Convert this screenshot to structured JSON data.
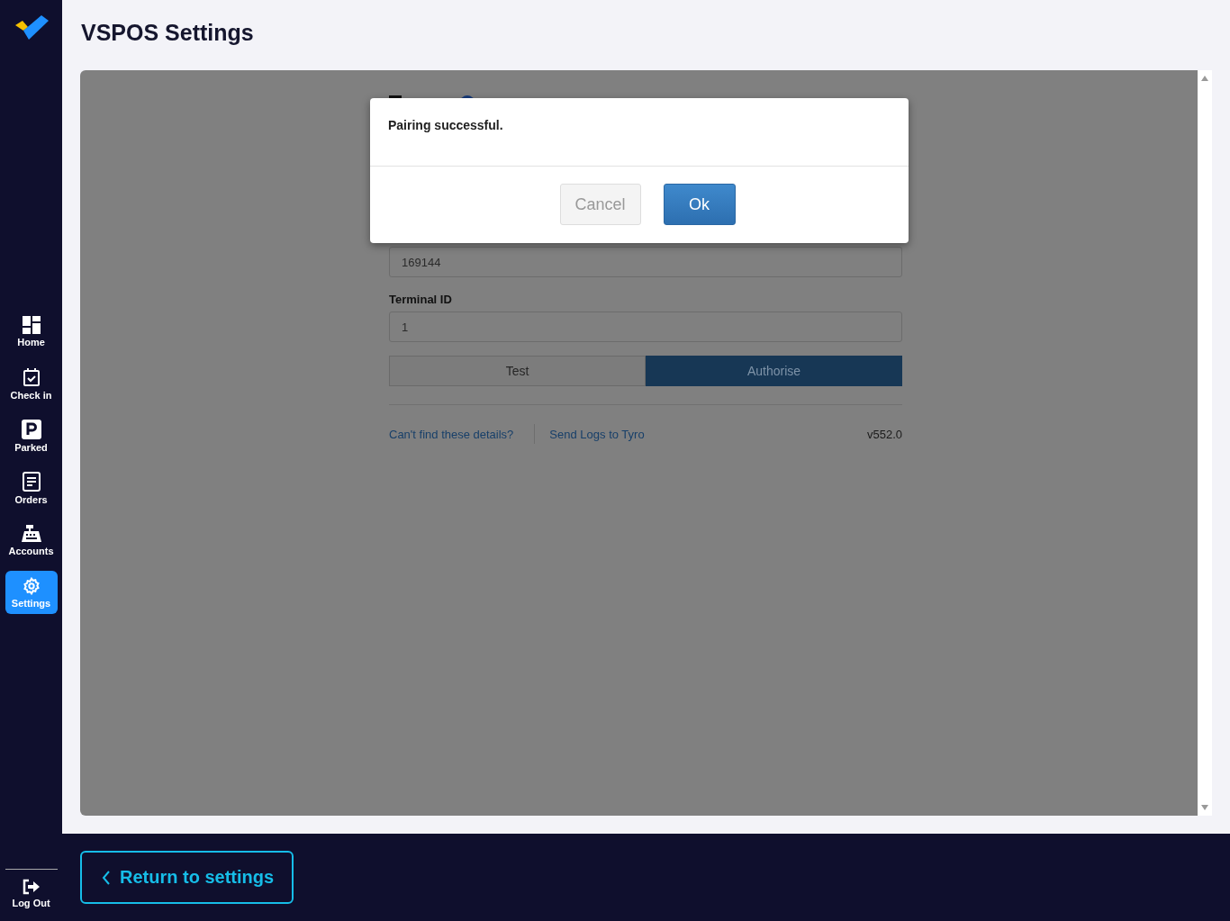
{
  "app": {
    "title": "VSPOS Settings"
  },
  "sidebar": {
    "items": [
      {
        "label": "Home",
        "kind": "grid",
        "selected": false
      },
      {
        "label": "Check in",
        "kind": "calendar",
        "selected": false
      },
      {
        "label": "Parked",
        "kind": "parking",
        "selected": false
      },
      {
        "label": "Orders",
        "kind": "document",
        "selected": false
      },
      {
        "label": "Accounts",
        "kind": "register",
        "selected": false
      },
      {
        "label": "Settings",
        "kind": "gear",
        "selected": true
      }
    ],
    "logout": "Log Out"
  },
  "tyro_form": {
    "merchant_id_value": "169144",
    "terminal_id_label": "Terminal ID",
    "terminal_id_value": "1",
    "buttons": [
      {
        "label": "Test",
        "primary": false
      },
      {
        "label": "Authorise",
        "primary": true
      }
    ],
    "links": [
      "Can't find these details?",
      "Send Logs to Tyro"
    ],
    "version": "v552.0"
  },
  "dialog": {
    "message": "Pairing successful.",
    "buttons": [
      {
        "label": "Cancel",
        "primary": false
      },
      {
        "label": "Ok",
        "primary": true
      }
    ]
  },
  "footer": {
    "return_button": "Return to settings"
  }
}
